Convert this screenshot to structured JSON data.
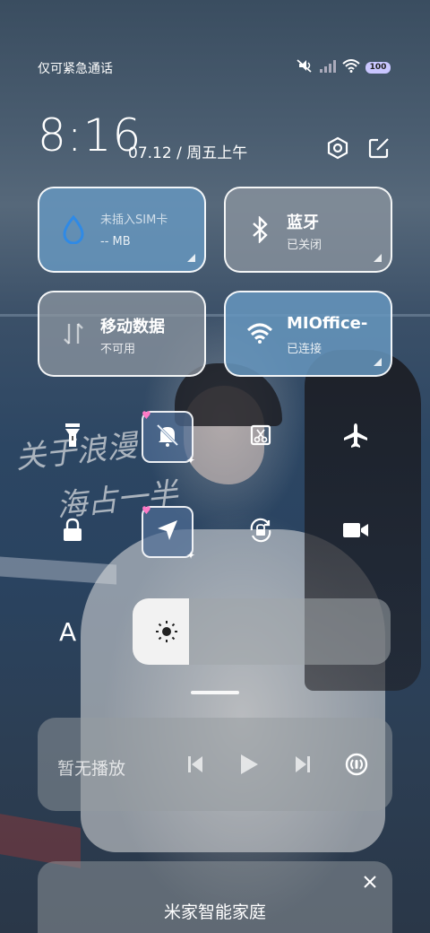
{
  "status_bar": {
    "carrier_text": "仅可紧急通话",
    "battery_level": "100",
    "icons": [
      "mute-icon",
      "signal-icon",
      "wifi-icon",
      "battery-icon"
    ]
  },
  "header": {
    "time": "8:16",
    "date": "07.12 / 周五上午",
    "icons": [
      "settings-icon",
      "edit-icon"
    ]
  },
  "tiles": {
    "data_usage": {
      "title": "未插入SIM卡",
      "value": "-- MB",
      "icon": "water-drop-icon"
    },
    "bluetooth": {
      "title": "蓝牙",
      "status": "已关闭",
      "icon": "bluetooth-icon"
    },
    "mobile_data": {
      "title": "移动数据",
      "status": "不可用",
      "icon": "data-arrows-icon"
    },
    "wifi": {
      "title": "MIOffice-",
      "status": "已连接",
      "icon": "wifi-icon"
    }
  },
  "toggles": [
    {
      "icon": "flashlight-icon"
    },
    {
      "icon": "mute-bell-icon",
      "active": true
    },
    {
      "icon": "screenshot-icon"
    },
    {
      "icon": "airplane-icon"
    },
    {
      "icon": "lock-icon"
    },
    {
      "icon": "location-icon",
      "active": true
    },
    {
      "icon": "rotation-lock-icon"
    },
    {
      "icon": "video-camera-icon"
    }
  ],
  "brightness": {
    "auto_label": "A",
    "level": 0.22
  },
  "media": {
    "label": "暂无播放",
    "icons": [
      "previous-icon",
      "play-icon",
      "next-icon",
      "cast-icon"
    ]
  },
  "smart_home": {
    "title": "米家智能家庭",
    "close_icon": "close-icon"
  },
  "wallpaper": {
    "handwriting_line1": "关于浪漫",
    "handwriting_line2": "海占一半"
  },
  "colors": {
    "tile_blue": "#6696be",
    "tile_gray": "#8c96a0",
    "battery": "#c9c6ff"
  }
}
